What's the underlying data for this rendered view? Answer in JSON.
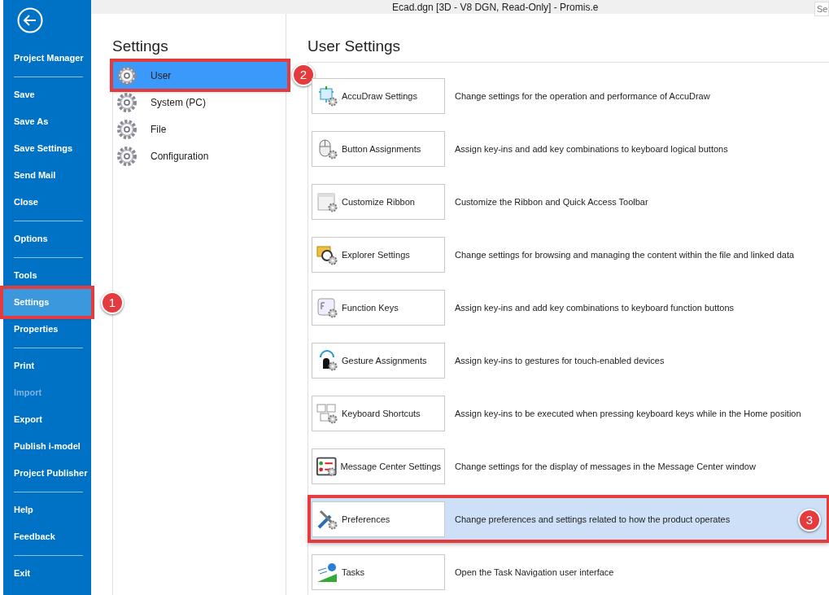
{
  "window": {
    "title": "Ecad.dgn [3D - V8 DGN, Read-Only] - Promis.e",
    "search": {
      "placeholder": "Se"
    }
  },
  "sidebar": {
    "groups": [
      [
        {
          "label": "Project Manager",
          "selected": false,
          "disabled": false
        }
      ],
      [
        {
          "label": "Save",
          "selected": false,
          "disabled": false
        },
        {
          "label": "Save As",
          "selected": false,
          "disabled": false
        },
        {
          "label": "Save Settings",
          "selected": false,
          "disabled": false
        },
        {
          "label": "Send Mail",
          "selected": false,
          "disabled": false
        },
        {
          "label": "Close",
          "selected": false,
          "disabled": false
        }
      ],
      [
        {
          "label": "Options",
          "selected": false,
          "disabled": false
        }
      ],
      [
        {
          "label": "Tools",
          "selected": false,
          "disabled": false
        },
        {
          "label": "Settings",
          "selected": true,
          "disabled": false,
          "callout": "1"
        },
        {
          "label": "Properties",
          "selected": false,
          "disabled": false
        }
      ],
      [
        {
          "label": "Print",
          "selected": false,
          "disabled": false
        },
        {
          "label": "Import",
          "selected": false,
          "disabled": true
        },
        {
          "label": "Export",
          "selected": false,
          "disabled": false
        },
        {
          "label": "Publish i-model",
          "selected": false,
          "disabled": false
        },
        {
          "label": "Project Publisher",
          "selected": false,
          "disabled": false
        }
      ],
      [
        {
          "label": "Help",
          "selected": false,
          "disabled": false
        },
        {
          "label": "Feedback",
          "selected": false,
          "disabled": false
        }
      ],
      [
        {
          "label": "Exit",
          "selected": false,
          "disabled": false
        }
      ]
    ]
  },
  "settings": {
    "title": "Settings",
    "items": [
      {
        "label": "User",
        "selected": true,
        "callout": "2"
      },
      {
        "label": "System (PC)",
        "selected": false
      },
      {
        "label": "File",
        "selected": false
      },
      {
        "label": "Configuration",
        "selected": false
      }
    ]
  },
  "user_settings": {
    "title": "User Settings",
    "rows": [
      {
        "button": "AccuDraw Settings",
        "description": "Change settings for the operation and performance of AccuDraw",
        "selected": false
      },
      {
        "button": "Button Assignments",
        "description": "Assign key-ins and add key combinations to keyboard logical buttons",
        "selected": false
      },
      {
        "button": "Customize Ribbon",
        "description": "Customize the Ribbon and Quick Access Toolbar",
        "selected": false
      },
      {
        "button": "Explorer Settings",
        "description": "Change settings for browsing and managing the content within the file and linked data",
        "selected": false
      },
      {
        "button": "Function Keys",
        "description": "Assign key-ins and add key combinations to keyboard function buttons",
        "selected": false
      },
      {
        "button": "Gesture Assignments",
        "description": "Assign key-ins to gestures for touch-enabled devices",
        "selected": false
      },
      {
        "button": "Keyboard Shortcuts",
        "description": "Assign key-ins to be executed when pressing keyboard keys while in the Home position",
        "selected": false
      },
      {
        "button": "Message Center Settings",
        "description": "Change settings for the display of messages in the Message Center window",
        "selected": false
      },
      {
        "button": "Preferences",
        "description": "Change preferences and settings related to how the product operates",
        "selected": true,
        "callout": "3"
      },
      {
        "button": "Tasks",
        "description": "Open the Task Navigation user interface",
        "selected": false
      }
    ]
  }
}
